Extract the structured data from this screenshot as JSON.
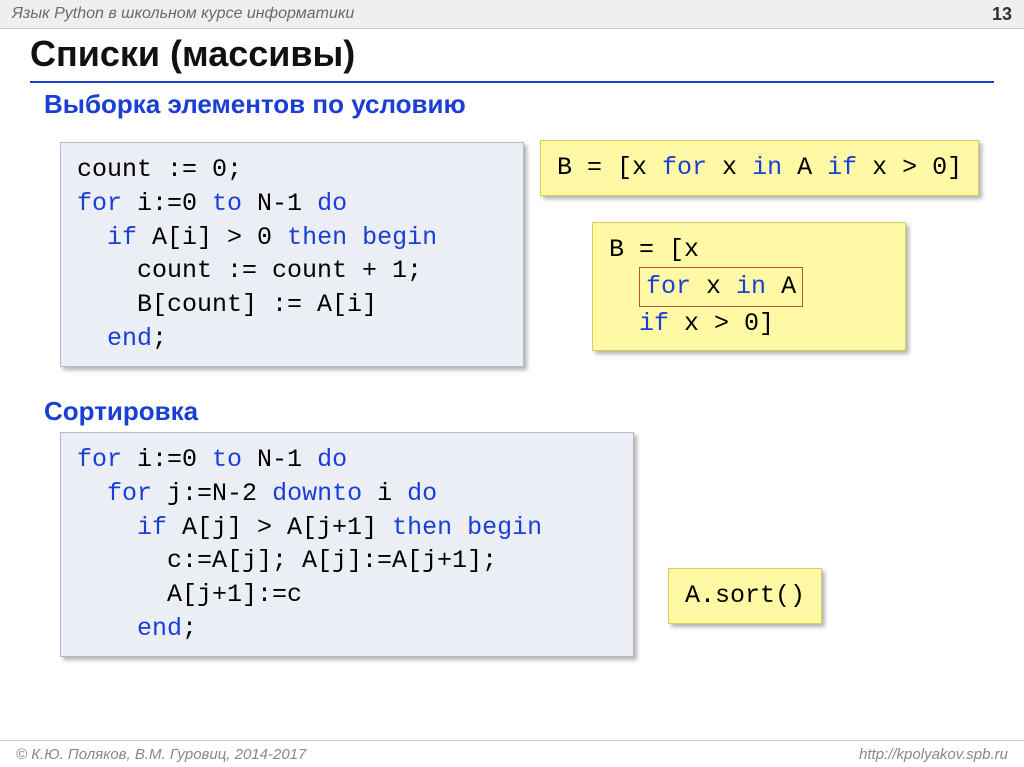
{
  "header": {
    "breadcrumb": "Язык Python в школьном курсе информатики",
    "page_number": "13"
  },
  "title": "Списки (массивы)",
  "section1_title": "Выборка элементов по условию",
  "pascal_filter": "count := 0;\nfor i:=0 to N-1 do\n  if A[i] > 0 then begin\n    count := count + 1;\n    B[count] := A[i]\n  end;",
  "python_filter_oneline": "B = [x for x in A if x > 0]",
  "python_filter_block_pre": "B = [x",
  "python_filter_block_mid": "for x in A",
  "python_filter_block_post": "  if x > 0]",
  "section2_title": "Сортировка",
  "pascal_sort": "for i:=0 to N-1 do\n  for j:=N-2 downto i do\n    if A[j] > A[j+1] then begin\n      c:=A[j]; A[j]:=A[j+1];\n      A[j+1]:=c\n    end;",
  "python_sort": "A.sort()",
  "footer": {
    "left": "© К.Ю. Поляков, В.М. Гуровиц, 2014-2017",
    "right": "http://kpolyakov.spb.ru"
  }
}
